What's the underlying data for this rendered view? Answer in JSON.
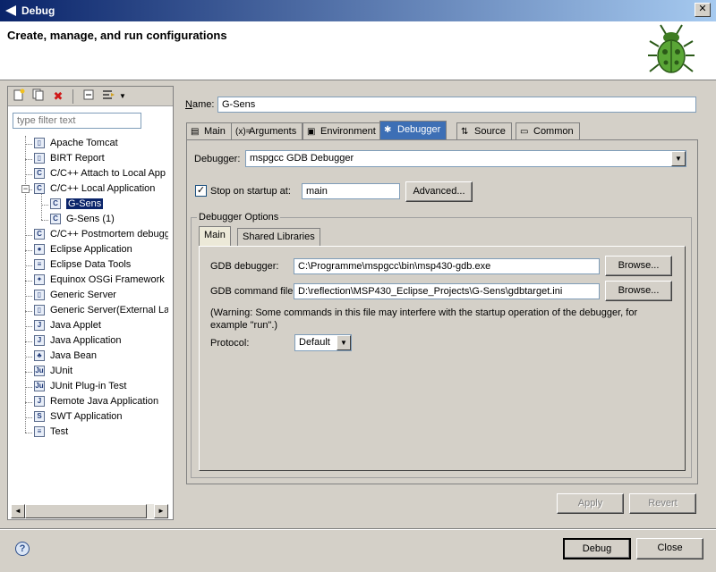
{
  "window": {
    "title": "Debug",
    "close_glyph": "✕"
  },
  "header": {
    "title": "Create, manage, and run configurations",
    "logo_icon": "bug-icon"
  },
  "left": {
    "toolbar_icons": [
      "new-config-icon",
      "duplicate-icon",
      "delete-icon",
      "collapse-all-icon",
      "filter-icon",
      "dropdown-icon"
    ],
    "filter_placeholder": "type filter text",
    "tree": [
      {
        "label": "Apache Tomcat",
        "icon": "server-icon",
        "glyph": "▯"
      },
      {
        "label": "BIRT Report",
        "icon": "report-icon",
        "glyph": "▯"
      },
      {
        "label": "C/C++ Attach to Local App",
        "icon": "c-icon",
        "glyph": "C"
      },
      {
        "label": "C/C++ Local Application",
        "icon": "c-icon",
        "glyph": "C",
        "expanded": true,
        "expander": "−"
      },
      {
        "label": "G-Sens",
        "icon": "c-icon",
        "glyph": "C",
        "child": true,
        "selected": true
      },
      {
        "label": "G-Sens (1)",
        "icon": "c-icon",
        "glyph": "C",
        "child": true
      },
      {
        "label": "C/C++ Postmortem debugg",
        "icon": "c-icon",
        "glyph": "C"
      },
      {
        "label": "Eclipse Application",
        "icon": "eclipse-icon",
        "glyph": "●"
      },
      {
        "label": "Eclipse Data Tools",
        "icon": "database-icon",
        "glyph": "≡"
      },
      {
        "label": "Equinox OSGi Framework",
        "icon": "osgi-icon",
        "glyph": "✦"
      },
      {
        "label": "Generic Server",
        "icon": "server-icon",
        "glyph": "▯"
      },
      {
        "label": "Generic Server(External La",
        "icon": "server-icon",
        "glyph": "▯"
      },
      {
        "label": "Java Applet",
        "icon": "applet-icon",
        "glyph": "J"
      },
      {
        "label": "Java Application",
        "icon": "java-icon",
        "glyph": "J"
      },
      {
        "label": "Java Bean",
        "icon": "bean-icon",
        "glyph": "♣"
      },
      {
        "label": "JUnit",
        "icon": "junit-icon",
        "glyph": "Ju"
      },
      {
        "label": "JUnit Plug-in Test",
        "icon": "junit-plugin-icon",
        "glyph": "Ju"
      },
      {
        "label": "Remote Java Application",
        "icon": "remote-java-icon",
        "glyph": "J"
      },
      {
        "label": "SWT Application",
        "icon": "swt-icon",
        "glyph": "S"
      },
      {
        "label": "Test",
        "icon": "test-icon",
        "glyph": "≡"
      }
    ],
    "scroll": {
      "left_glyph": "◄",
      "right_glyph": "►"
    }
  },
  "right": {
    "name_label_prefix": "N",
    "name_label_rest": "ame:",
    "name_value": "G-Sens",
    "tabs": [
      {
        "label": "Main",
        "icon": "main-tab-icon",
        "glyph": "▤"
      },
      {
        "label": "Arguments",
        "icon": "arguments-icon",
        "glyph": "(x)="
      },
      {
        "label": "Environment",
        "icon": "environment-icon",
        "glyph": "▣"
      },
      {
        "label": "Debugger",
        "icon": "debugger-icon",
        "glyph": "✱",
        "active": true
      },
      {
        "label": "Source",
        "icon": "source-icon",
        "glyph": "⇅"
      },
      {
        "label": "Common",
        "icon": "common-icon",
        "glyph": "▭"
      }
    ],
    "debugger_label": "Debugger:",
    "debugger_value": "mspgcc GDB Debugger",
    "stop_on_startup_label": "Stop on startup at:",
    "stop_on_startup_checked": true,
    "stop_on_startup_value": "main",
    "advanced_label": "Advanced...",
    "group_title": "Debugger Options",
    "subtabs": [
      {
        "label": "Main",
        "active": true
      },
      {
        "label": "Shared Libraries"
      }
    ],
    "gdb_debugger_label": "GDB debugger:",
    "gdb_debugger_value": "C:\\Programme\\mspgcc\\bin\\msp430-gdb.exe",
    "gdb_cmd_label": "GDB command file:",
    "gdb_cmd_value": "D:\\reflection\\MSP430_Eclipse_Projects\\G-Sens\\gdbtarget.ini",
    "browse_label": "Browse...",
    "warning": "(Warning: Some commands in this file may interfere with the startup operation of the debugger, for example \"run\".)",
    "protocol_label": "Protocol:",
    "protocol_value": "Default",
    "apply_label": "Apply",
    "revert_label": "Revert"
  },
  "footer": {
    "help_glyph": "?",
    "debug_label": "Debug",
    "close_label": "Close"
  },
  "colors": {
    "title_bar": "#0a246a",
    "selection": "#0a246a",
    "active_tab": "#3d6fb5"
  }
}
